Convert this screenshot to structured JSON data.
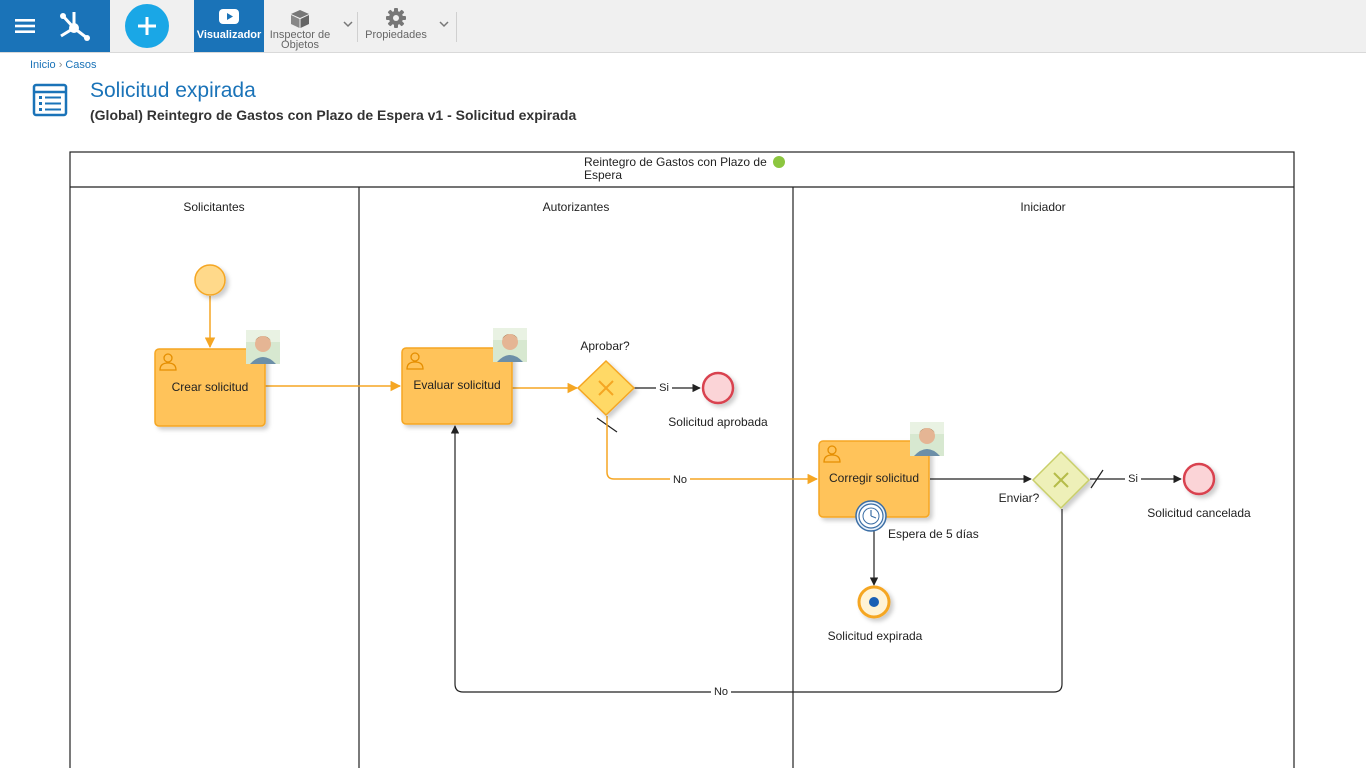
{
  "toolbar": {
    "visualizador": "Visualizador",
    "inspector_line1": "Inspector de",
    "inspector_line2": "Objetos",
    "propiedades": "Propiedades"
  },
  "breadcrumb": {
    "inicio": "Inicio",
    "separator": "›",
    "casos": "Casos"
  },
  "page": {
    "title": "Solicitud expirada",
    "subtitle": "(Global) Reintegro de Gastos con Plazo de Espera v1 - Solicitud expirada"
  },
  "diagram": {
    "pool_title_line1": "Reintegro de Gastos con Plazo de",
    "pool_title_line2": "Espera",
    "lanes": [
      "Solicitantes",
      "Autorizantes",
      "Iniciador"
    ],
    "tasks": {
      "crear": "Crear solicitud",
      "evaluar": "Evaluar solicitud",
      "corregir": "Corregir solicitud"
    },
    "gateways": {
      "aprobar": "Aprobar?",
      "enviar": "Enviar?"
    },
    "flows": {
      "si_1": "Si",
      "no_1": "No",
      "si_2": "Si",
      "no_2": "No"
    },
    "events": {
      "aprobada": "Solicitud aprobada",
      "cancelada": "Solicitud cancelada",
      "expirada": "Solicitud expirada",
      "timer": "Espera de 5 días"
    }
  },
  "colors": {
    "brand_blue": "#1a73b8",
    "add_button": "#1aa7e6",
    "task_fill": "#ffc35a",
    "task_border": "#f5a623",
    "gateway_active": "#ffd966",
    "gateway_inactive": "#eef0b8",
    "end_event": "#d9434f",
    "status_dot": "#8cc63f"
  }
}
